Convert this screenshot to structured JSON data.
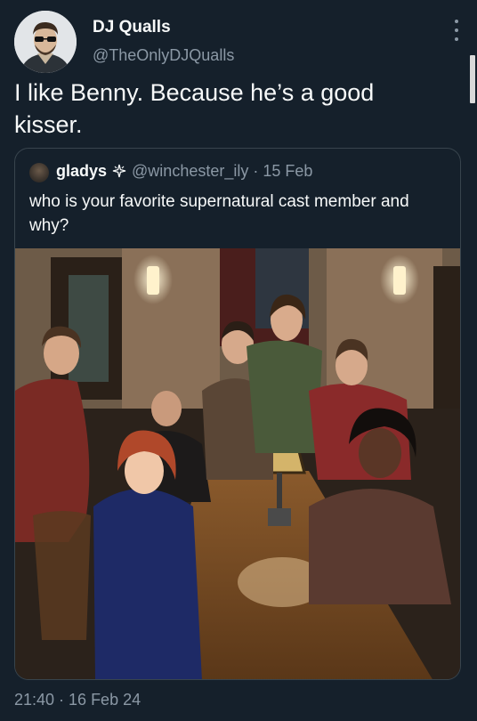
{
  "author": {
    "name": "DJ Qualls",
    "handle": "@TheOnlyDJQualls"
  },
  "tweet": {
    "text": "I like Benny. Because he’s a good kisser.",
    "timestamp": "21:40 · 16 Feb 24"
  },
  "quoted_tweet": {
    "name": "gladys",
    "handle_and_date": "@winchester_ily · 15 Feb",
    "text": "who is your favorite supernatural cast member and why?"
  },
  "colors": {
    "background": "#15202b",
    "text_primary": "#f7f9f9",
    "text_secondary": "#8b98a5",
    "border": "#38444d"
  },
  "icons": {
    "more": "more-vertical-icon",
    "badge": "sparkle-badge-icon"
  }
}
